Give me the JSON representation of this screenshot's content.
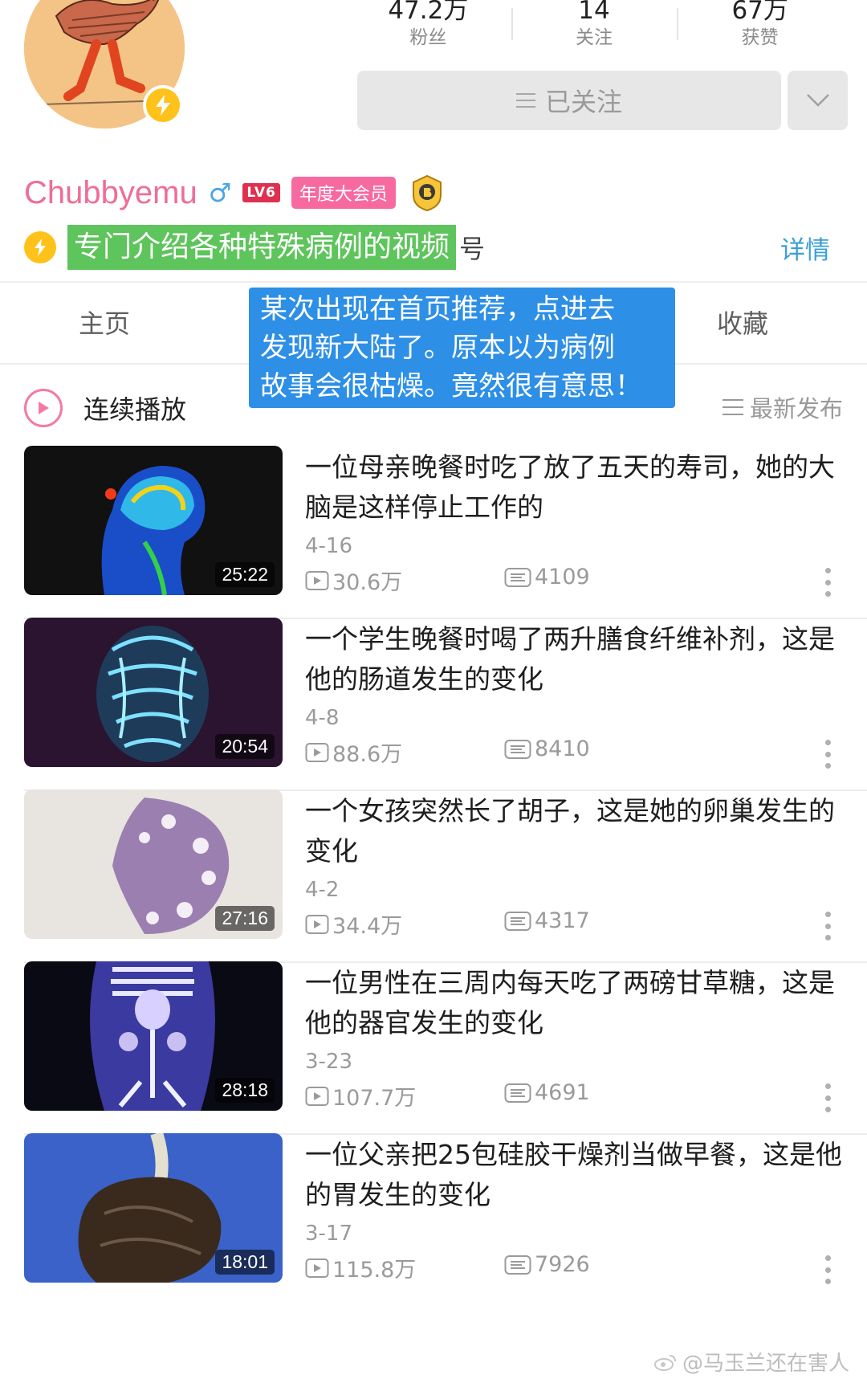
{
  "profile": {
    "stats": [
      {
        "value": "47.2万",
        "label": "粉丝"
      },
      {
        "value": "14",
        "label": "关注"
      },
      {
        "value": "67万",
        "label": "获赞"
      }
    ],
    "follow_label": "已关注",
    "username": "Chubbyemu",
    "gender_symbol": "♂",
    "level": "LV6",
    "vip_badge": "年度大会员",
    "bio": "专门介绍各种特殊病例的视频",
    "bio_suffix": "号",
    "detail_link": "详情",
    "colors": {
      "username": "#ee6e96",
      "vip": "#f76aa0",
      "bio_highlight": "#5ec45c",
      "link": "#3a9fd8"
    }
  },
  "tabs": {
    "home": "主页",
    "favorites": "收藏"
  },
  "overlay_note": {
    "line1": "某次出现在首页推荐，点进去",
    "line2": "发现新大陆了。原本以为病例",
    "line3": "故事会很枯燥。竟然很有意思！"
  },
  "playlist": {
    "play_label": "连续播放",
    "sort_label": "最新发布"
  },
  "videos": [
    {
      "title": "一位母亲晚餐时吃了放了五天的寿司，她的大脑是这样停止工作的",
      "duration": "25:22",
      "date": "4-16",
      "plays": "30.6万",
      "danmaku": "4109",
      "thumb": "brain-scan"
    },
    {
      "title": "一个学生晚餐时喝了两升膳食纤维补剂，这是他的肠道发生的变化",
      "duration": "20:54",
      "date": "4-8",
      "plays": "88.6万",
      "danmaku": "8410",
      "thumb": "intestine-xray"
    },
    {
      "title": "一个女孩突然长了胡子，这是她的卵巢发生的变化",
      "duration": "27:16",
      "date": "4-2",
      "plays": "34.4万",
      "danmaku": "4317",
      "thumb": "ovary-slide"
    },
    {
      "title": "一位男性在三周内每天吃了两磅甘草糖，这是他的器官发生的变化",
      "duration": "28:18",
      "date": "3-23",
      "plays": "107.7万",
      "danmaku": "4691",
      "thumb": "organ-ct"
    },
    {
      "title": "一位父亲把25包硅胶干燥剂当做早餐，这是他的胃发生的变化",
      "duration": "18:01",
      "date": "3-17",
      "plays": "115.8万",
      "danmaku": "7926",
      "thumb": "stomach-specimen"
    }
  ],
  "watermark": "@马玉兰还在害人"
}
